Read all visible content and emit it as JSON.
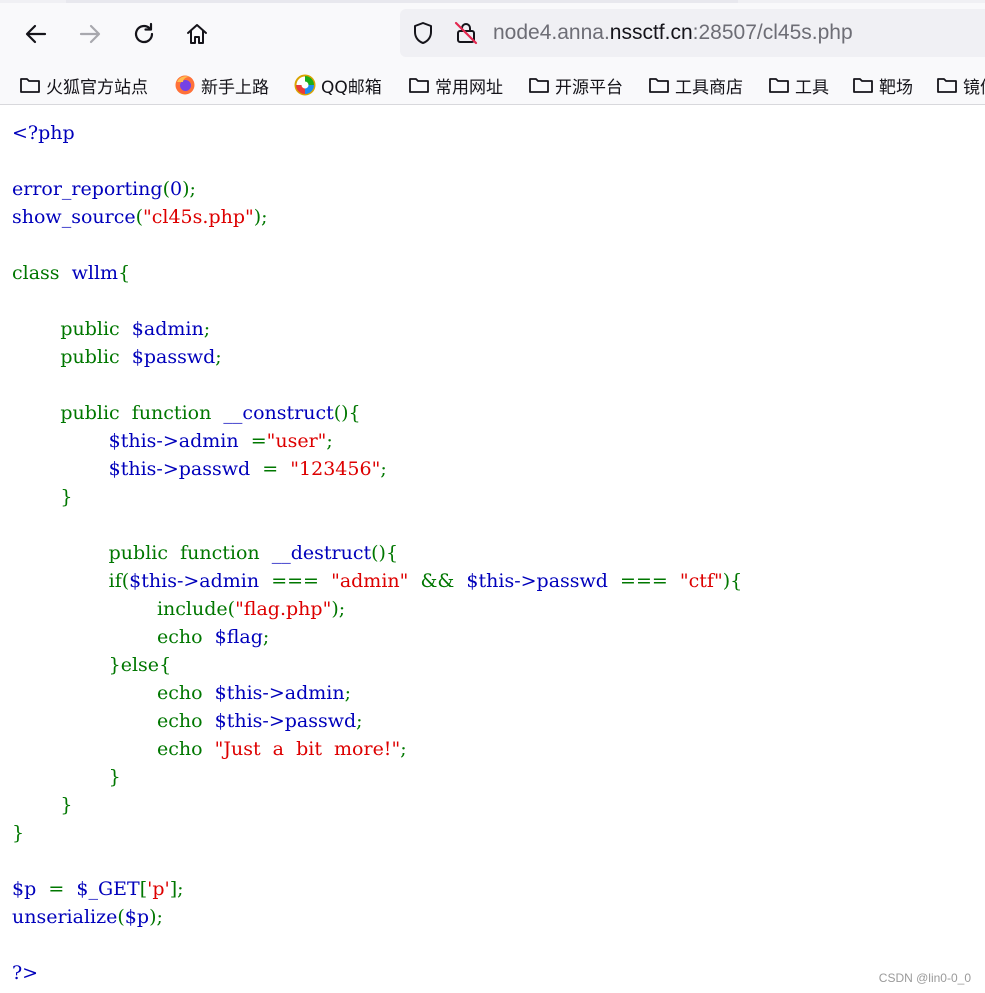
{
  "browser": {
    "url_host_prefix": "node4.anna.",
    "url_host_domain": "nssctf.cn",
    "url_rest": ":28507/cl45s.php",
    "icons": [
      "back-arrow-icon",
      "forward-arrow-icon",
      "reload-icon",
      "home-icon",
      "shield-icon",
      "insecure-lock-icon",
      "folder-icon",
      "firefox-icon",
      "qq-mail-icon"
    ]
  },
  "bookmarks": [
    {
      "label": "火狐官方站点",
      "icon": "folder-icon"
    },
    {
      "label": "新手上路",
      "icon": "firefox-icon"
    },
    {
      "label": "QQ邮箱",
      "icon": "qq-mail-icon"
    },
    {
      "label": "常用网址",
      "icon": "folder-icon"
    },
    {
      "label": "开源平台",
      "icon": "folder-icon"
    },
    {
      "label": "工具商店",
      "icon": "folder-icon"
    },
    {
      "label": "工具",
      "icon": "folder-icon"
    },
    {
      "label": "靶场",
      "icon": "folder-icon"
    },
    {
      "label": "镜像",
      "icon": "folder-icon"
    }
  ],
  "code": {
    "open_tag": "<?php",
    "line_error_reporting": "error_reporting",
    "line_error_value": "0",
    "line_show_source": "show_source",
    "line_show_source_arg": "\"cl45s.php\"",
    "kw_class": "class",
    "class_name": "wllm",
    "kw_public": "public",
    "var_admin": "$admin",
    "var_passwd": "$passwd",
    "kw_function": "function",
    "fn_construct": "__construct",
    "this_admin": "$this->admin",
    "this_passwd": "$this->passwd",
    "str_user": "\"user\"",
    "str_123456": "\"123456\"",
    "fn_destruct": "__destruct",
    "kw_if": "if",
    "op_identical": "===",
    "str_admin": "\"admin\"",
    "op_and": "&&",
    "str_ctf": "\"ctf\"",
    "kw_include": "include",
    "str_flag_php": "\"flag.php\"",
    "kw_echo": "echo",
    "var_flag": "$flag",
    "kw_else": "else",
    "str_just_a_bit": "\"Just  a  bit  more!\"",
    "var_p": "$p",
    "var_get": "$_GET",
    "str_p": "'p'",
    "fn_unserialize": "unserialize",
    "close_tag": "?>"
  },
  "watermark": "CSDN @lin0-0_0",
  "colors": {
    "php_default": "#0000bb",
    "php_keyword": "#007700",
    "php_string": "#dd0000",
    "toolbar_bg": "#f9f9fb",
    "urlbar_bg": "#f0f0f4"
  }
}
